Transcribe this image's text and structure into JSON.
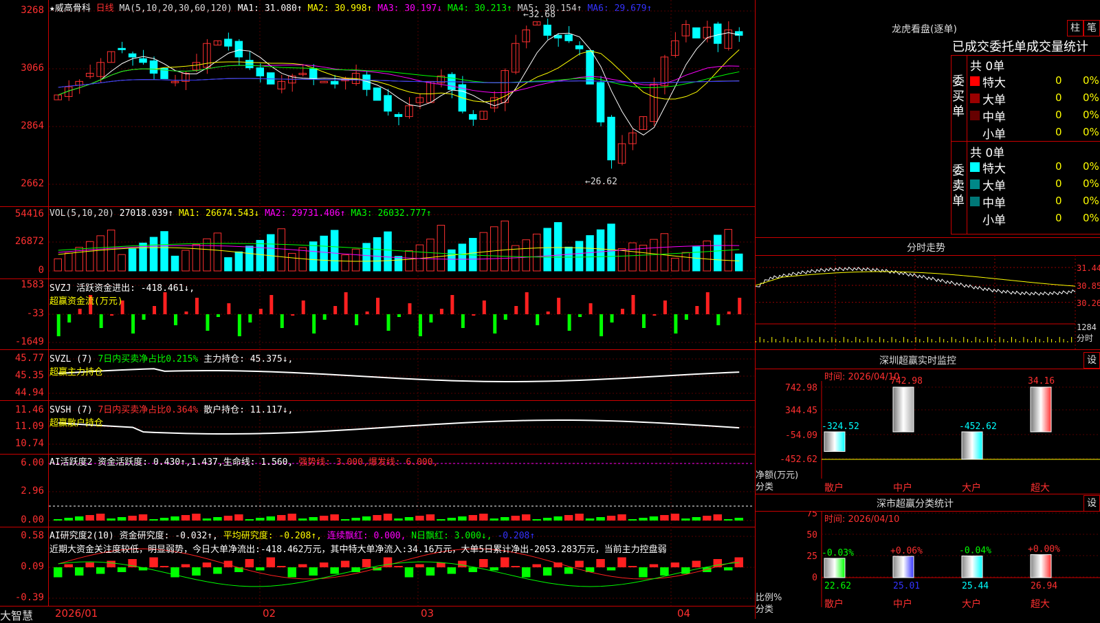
{
  "main": {
    "title": "★威高骨科",
    "period": "日线",
    "ma_header": "MA(5,10,20,30,60,120)",
    "ma_values": [
      {
        "label": "MA1: 31.080↑",
        "color": "#ffffff"
      },
      {
        "label": "MA2: 30.998↑",
        "color": "#ffff00"
      },
      {
        "label": "MA3: 30.197↓",
        "color": "#ff00ff"
      },
      {
        "label": "MA4: 30.213↑",
        "color": "#00ff00"
      },
      {
        "label": "MA5: 30.154↑",
        "color": "#cccccc"
      },
      {
        "label": "MA6: 29.679↑",
        "color": "#3333ff"
      }
    ],
    "y_ticks": [
      "3268",
      "3066",
      "2864",
      "2662"
    ],
    "high_label": "32.68",
    "low_label": "26.62"
  },
  "volume": {
    "header": "VOL(5,10,20)",
    "values": [
      {
        "label": "27018.039↑",
        "color": "#ffffff"
      },
      {
        "label": "MA1: 26674.543↓",
        "color": "#ffff00"
      },
      {
        "label": "MA2: 29731.406↑",
        "color": "#ff00ff"
      },
      {
        "label": "MA3: 26032.777↑",
        "color": "#00ff00"
      }
    ],
    "y_ticks": [
      "54416",
      "26872",
      "0"
    ]
  },
  "svzj": {
    "header": "SVZJ  活跃资金进出: -418.461↓,",
    "subtitle": "超赢资金流(万元)",
    "y_ticks": [
      "1583",
      "-33",
      "-1649"
    ]
  },
  "svzl": {
    "header_a": "SVZL (7)",
    "header_b": "7日内买卖净占比0.215%",
    "header_c": "主力持仓: 45.375↓,",
    "subtitle": "超赢主力持仓",
    "y_ticks": [
      "45.77",
      "45.35",
      "44.94"
    ]
  },
  "svsh": {
    "header_a": "SVSH (7)",
    "header_b": "7日内买卖净占比0.364%",
    "header_c": "散户持仓: 11.117↓,",
    "subtitle": "超赢散户持仓",
    "y_ticks": [
      "11.46",
      "11.09",
      "10.74"
    ]
  },
  "ai_active": {
    "header_a": "AI活跃度2 资金活跃度: 0.430↑,1.437,生命线: 1.560,",
    "header_b": "强势线: 3.000,爆发线: 6.000,",
    "y_ticks": [
      "6.00",
      "2.96",
      "0.00"
    ]
  },
  "ai_research": {
    "header_a": "AI研究度2(10) 资金研究度: -0.032↑,",
    "header_b": "平均研究度: -0.208↑,",
    "header_c": "连续飘红: 0.000,",
    "header_d": "N日飘红: 3.000↓,",
    "header_e": "-0.208↑",
    "comment": "近期大资金关注度较低，明显弱势，今日大单净流出:-418.462万元，其中特大单净流入:34.16万元，大单5日累计净出-2053.283万元，当前主力控盘弱",
    "y_ticks": [
      "0.58",
      "0.09",
      "-0.39"
    ]
  },
  "x_axis": {
    "labels": [
      "2026/01",
      "02",
      "03",
      "04"
    ]
  },
  "brand": "大智慧",
  "right": {
    "dragon_title": "龙虎看盘(逐单)",
    "btn_zhu": "柱",
    "btn_bi": "笔",
    "tabs": "已成交委托单成交量统计",
    "buy_side": "委买单",
    "sell_side": "委卖单",
    "buy_total": "共 0单",
    "sell_total": "共 0单",
    "buy_rows": [
      {
        "label": "特大",
        "val": "0",
        "pct": "0%",
        "color": "#ff0000"
      },
      {
        "label": "大单",
        "val": "0",
        "pct": "0%",
        "color": "#990000"
      },
      {
        "label": "中单",
        "val": "0",
        "pct": "0%",
        "color": "#660000"
      },
      {
        "label": "小单",
        "val": "0",
        "pct": "0%",
        "color": ""
      }
    ],
    "sell_rows": [
      {
        "label": "特大",
        "val": "0",
        "pct": "0%",
        "color": "#00ffff"
      },
      {
        "label": "大单",
        "val": "0",
        "pct": "0%",
        "color": "#008888"
      },
      {
        "label": "中单",
        "val": "0",
        "pct": "0%",
        "color": "#007777"
      },
      {
        "label": "小单",
        "val": "0",
        "pct": "0%",
        "color": ""
      }
    ],
    "intraday_title": "分时走势",
    "intraday_y": [
      "31.44",
      "30.85",
      "30.26",
      "1284",
      "分时"
    ],
    "monitor_title": "深圳超赢实时监控",
    "monitor_btn": "设",
    "monitor_time": "时间: 2026/04/10",
    "monitor_y": [
      "742.98",
      "344.45",
      "-54.09",
      "-452.62"
    ],
    "monitor_axis_label": "净额(万元)",
    "monitor_axis_label2": "分类",
    "monitor_bars": [
      {
        "cat": "散户",
        "value": -324.52,
        "label": "-324.52"
      },
      {
        "cat": "中户",
        "value": 742.98,
        "label": "742.98"
      },
      {
        "cat": "大户",
        "value": -452.62,
        "label": "-452.62"
      },
      {
        "cat": "超大",
        "value": 34.16,
        "label": "34.16"
      }
    ],
    "stat_title": "深市超赢分类统计",
    "stat_btn": "设",
    "stat_time": "时间: 2026/04/10",
    "stat_y": [
      "75",
      "50",
      "25",
      "0"
    ],
    "stat_axis_label": "比例%",
    "stat_axis_label2": "分类",
    "stat_bars": [
      {
        "cat": "散户",
        "value": 22.62,
        "label": "22.62",
        "delta": "-0.03%"
      },
      {
        "cat": "中户",
        "value": 25.01,
        "label": "25.01",
        "delta": "+0.06%"
      },
      {
        "cat": "大户",
        "value": 25.44,
        "label": "25.44",
        "delta": "-0.04%"
      },
      {
        "cat": "超大",
        "value": 26.94,
        "label": "26.94",
        "delta": "+0.00%"
      }
    ]
  },
  "chart_data": {
    "type": "bar",
    "title": "",
    "categories": [
      "散户",
      "中户",
      "大户",
      "超大"
    ],
    "series": [
      {
        "name": "净额(万元)",
        "values": [
          -324.52,
          742.98,
          -452.62,
          34.16
        ]
      },
      {
        "name": "比例%",
        "values": [
          22.62,
          25.01,
          25.44,
          26.94
        ]
      }
    ],
    "xlabel": "分类",
    "ylabel": "",
    "ylim": [
      -452.62,
      742.98
    ],
    "price_range": [
      26.62,
      32.68
    ]
  }
}
